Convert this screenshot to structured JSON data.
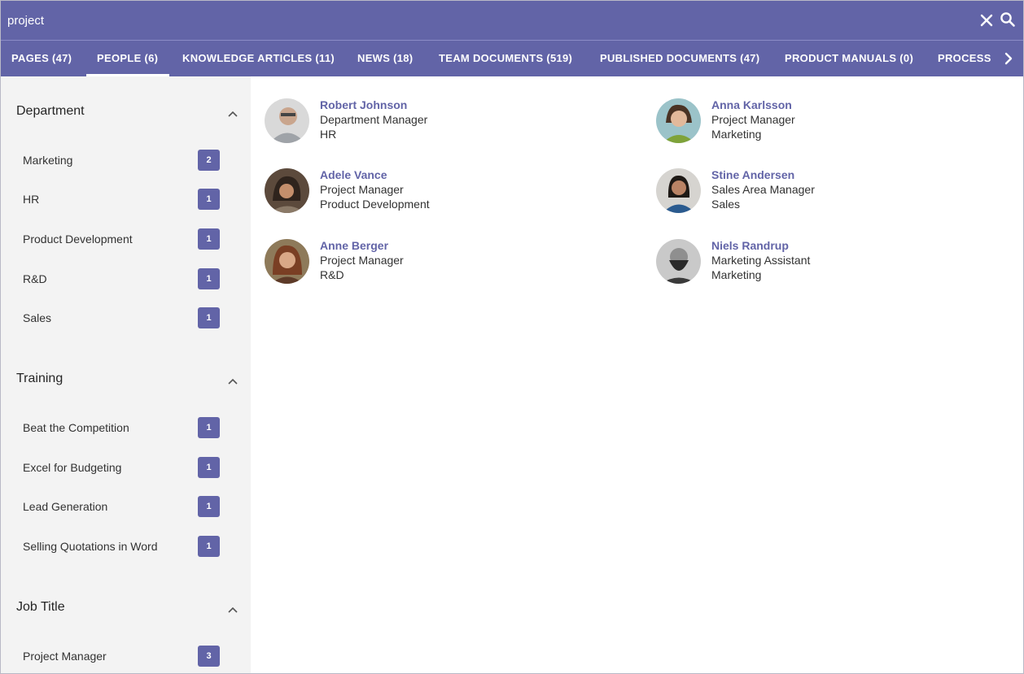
{
  "search": {
    "value": "project"
  },
  "tabs": [
    {
      "label": "PAGES (47)"
    },
    {
      "label": "PEOPLE (6)"
    },
    {
      "label": "KNOWLEDGE ARTICLES (11)"
    },
    {
      "label": "NEWS (18)"
    },
    {
      "label": "TEAM DOCUMENTS (519)"
    },
    {
      "label": "PUBLISHED DOCUMENTS (47)"
    },
    {
      "label": "PRODUCT MANUALS (0)"
    },
    {
      "label": "PROCESS"
    }
  ],
  "active_tab": "PEOPLE (6)",
  "facets": {
    "department": {
      "title": "Department",
      "items": [
        {
          "label": "Marketing",
          "count": "2"
        },
        {
          "label": "HR",
          "count": "1"
        },
        {
          "label": "Product Development",
          "count": "1"
        },
        {
          "label": "R&D",
          "count": "1"
        },
        {
          "label": "Sales",
          "count": "1"
        }
      ]
    },
    "training": {
      "title": "Training",
      "items": [
        {
          "label": "Beat the Competition",
          "count": "1"
        },
        {
          "label": "Excel for Budgeting",
          "count": "1"
        },
        {
          "label": "Lead Generation",
          "count": "1"
        },
        {
          "label": "Selling Quotations in Word",
          "count": "1"
        }
      ]
    },
    "job_title": {
      "title": "Job Title",
      "items": [
        {
          "label": "Project Manager",
          "count": "3"
        }
      ]
    }
  },
  "people": [
    {
      "name": "Robert Johnson",
      "title": "Department Manager",
      "department": "HR"
    },
    {
      "name": "Anna Karlsson",
      "title": "Project Manager",
      "department": "Marketing"
    },
    {
      "name": "Adele Vance",
      "title": "Project Manager",
      "department": "Product Development"
    },
    {
      "name": "Stine Andersen",
      "title": "Sales Area Manager",
      "department": "Sales"
    },
    {
      "name": "Anne Berger",
      "title": "Project Manager",
      "department": "R&D"
    },
    {
      "name": "Niels Randrup",
      "title": "Marketing Assistant",
      "department": "Marketing"
    }
  ],
  "colors": {
    "brand": "#6264a7",
    "sidebar_bg": "#f3f3f3",
    "badge": "#6264a7"
  }
}
